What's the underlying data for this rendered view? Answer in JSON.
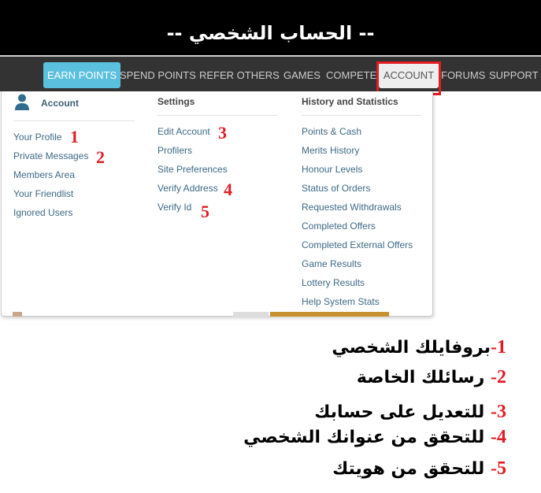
{
  "banner": {
    "title": "-- الحساب الشخصي --"
  },
  "nav": {
    "items": [
      {
        "label": "EARN POINTS"
      },
      {
        "label": "SPEND POINTS"
      },
      {
        "label": "REFER OTHERS"
      },
      {
        "label": "GAMES"
      },
      {
        "label": "COMPETE"
      },
      {
        "label": "ACCOUNT"
      },
      {
        "label": "FORUMS"
      },
      {
        "label": "SUPPORT"
      }
    ],
    "active": "ACCOUNT",
    "colors": {
      "bar": "#333333",
      "earn": "#5bc0de",
      "active": "#eeeeee",
      "highlight": "#e31b23"
    }
  },
  "dropdown": {
    "account": {
      "heading": "Account",
      "icon": "user-icon",
      "links": [
        "Your Profile",
        "Private Messages",
        "Members Area",
        "Your Friendlist",
        "Ignored Users"
      ]
    },
    "settings": {
      "heading": "Settings",
      "links": [
        "Edit Account",
        "Profilers",
        "Site Preferences",
        "Verify Address",
        "Verify Id"
      ]
    },
    "history": {
      "heading": "History and Statistics",
      "links": [
        "Points & Cash",
        "Merits History",
        "Honour Levels",
        "Status of Orders",
        "Requested Withdrawals",
        "Completed Offers",
        "Completed External Offers",
        "Game Results",
        "Lottery Results",
        "Help System Stats"
      ]
    }
  },
  "annotations": {
    "numbers": [
      "1",
      "2",
      "3",
      "4",
      "5"
    ],
    "arabic": [
      {
        "num": "1-",
        "text": "بروفايلك الشخصي"
      },
      {
        "num": "2-",
        "text": "رسائلك الخاصة"
      },
      {
        "num": "3-",
        "text": "للتعديل على حسابك"
      },
      {
        "num": "4-",
        "text": "للتحقق من عنوانك الشخصي"
      },
      {
        "num": "5-",
        "text": "للتحقق من هويتك"
      }
    ]
  }
}
